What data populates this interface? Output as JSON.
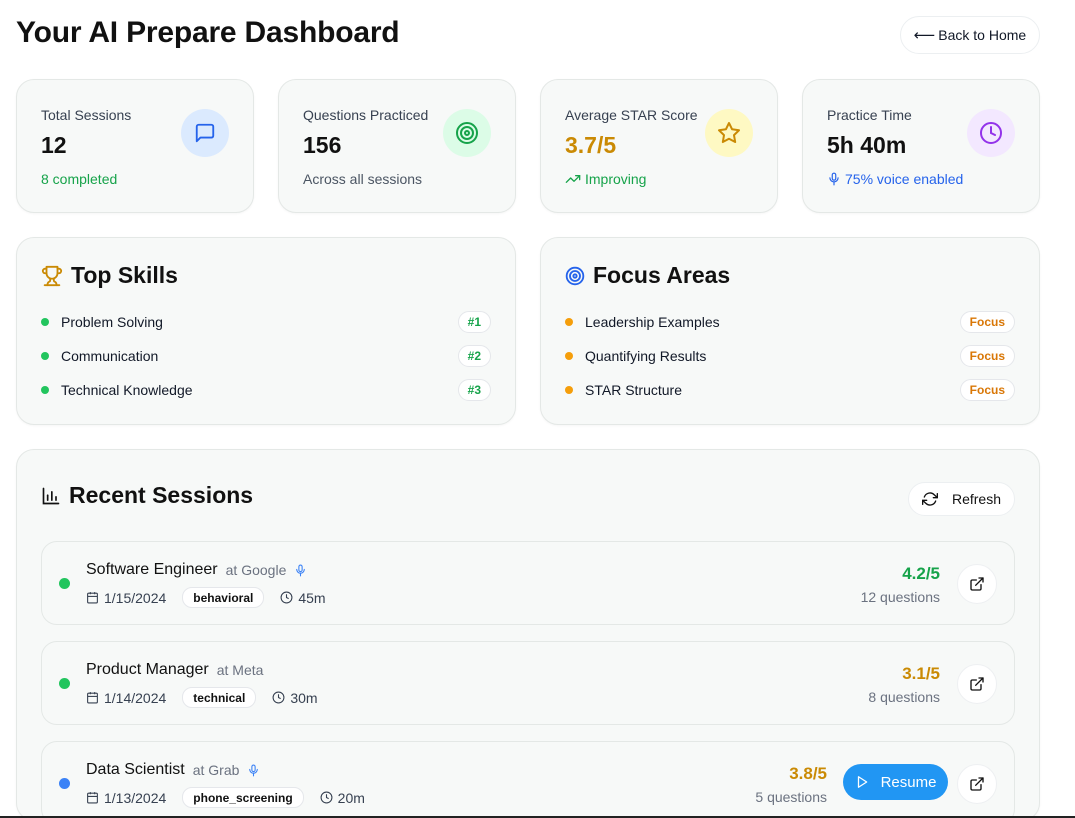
{
  "header": {
    "title": "Your AI Prepare Dashboard",
    "back_arrow": "⟵",
    "back_label": "Back to Home"
  },
  "stats": [
    {
      "label": "Total Sessions",
      "value": "12",
      "sub": "8 completed",
      "icon": "message-icon",
      "color": "#16a34a"
    },
    {
      "label": "Questions Practiced",
      "value": "156",
      "sub": "Across all sessions",
      "icon": "target-icon",
      "color": "#4b5563"
    },
    {
      "label": "Average STAR Score",
      "value": "3.7/5",
      "sub": "Improving",
      "icon": "star-icon",
      "color": "#16a34a"
    },
    {
      "label": "Practice Time",
      "value": "5h 40m",
      "sub": "75% voice enabled",
      "icon": "clock-icon",
      "color": "#2563eb"
    }
  ],
  "top_skills": {
    "title": "Top Skills",
    "items": [
      {
        "label": "Problem Solving",
        "rank": "#1"
      },
      {
        "label": "Communication",
        "rank": "#2"
      },
      {
        "label": "Technical Knowledge",
        "rank": "#3"
      }
    ]
  },
  "focus_areas": {
    "title": "Focus Areas",
    "items": [
      {
        "label": "Leadership Examples",
        "tag": "Focus"
      },
      {
        "label": "Quantifying Results",
        "tag": "Focus"
      },
      {
        "label": "STAR Structure",
        "tag": "Focus"
      }
    ]
  },
  "recent": {
    "title": "Recent Sessions",
    "refresh_label": "Refresh",
    "resume_label": "Resume",
    "sessions": [
      {
        "role": "Software Engineer",
        "company": "at Google",
        "voice": true,
        "date": "1/15/2024",
        "type": "behavioral",
        "duration": "45m",
        "score": "4.2/5",
        "questions": "12 questions",
        "status_color": "#22c55e",
        "score_color": "#16a34a",
        "resume": false
      },
      {
        "role": "Product Manager",
        "company": "at Meta",
        "voice": false,
        "date": "1/14/2024",
        "type": "technical",
        "duration": "30m",
        "score": "3.1/5",
        "questions": "8 questions",
        "status_color": "#22c55e",
        "score_color": "#ca8a04",
        "resume": false
      },
      {
        "role": "Data Scientist",
        "company": "at Grab",
        "voice": true,
        "date": "1/13/2024",
        "type": "phone_screening",
        "duration": "20m",
        "score": "3.8/5",
        "questions": "5 questions",
        "status_color": "#3b82f6",
        "score_color": "#ca8a04",
        "resume": true
      }
    ]
  },
  "colors": {
    "green": "#16a34a",
    "amber": "#ca8a04",
    "blue": "#2563eb",
    "orange": "#f59e0b",
    "primary": "#2196f3"
  }
}
